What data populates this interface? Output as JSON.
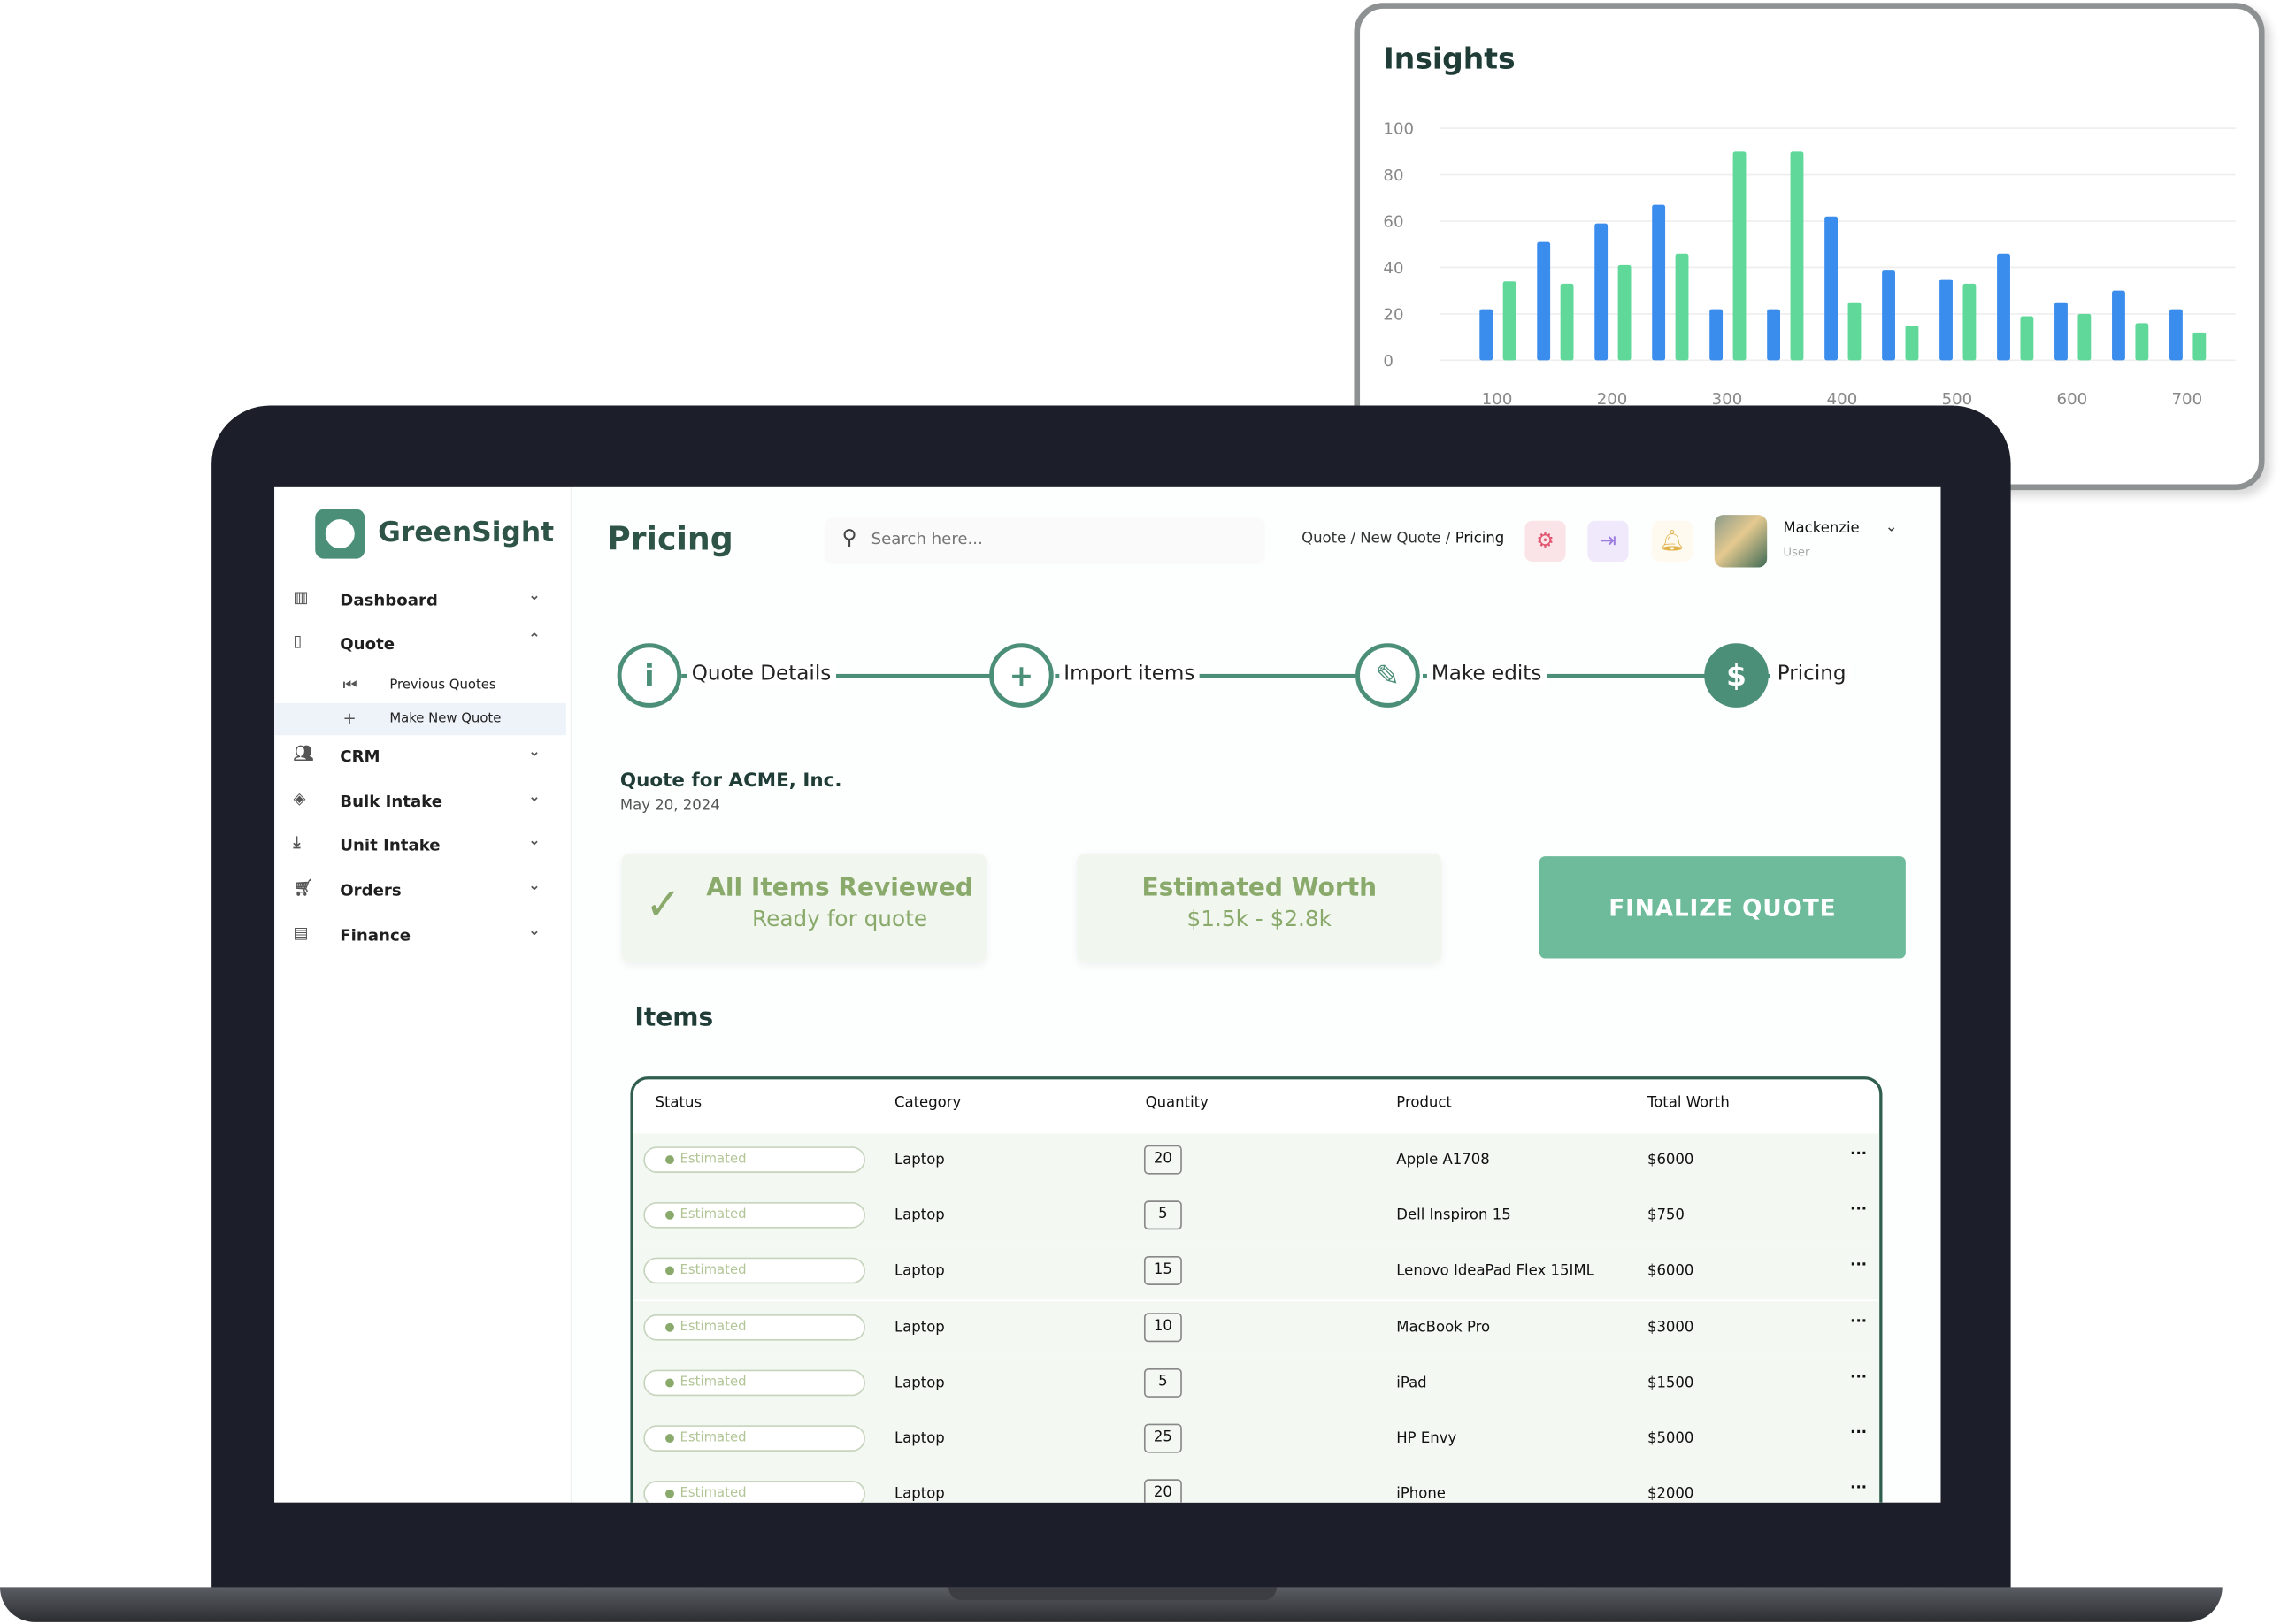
{
  "insights": {
    "title": "Insights"
  },
  "chart_data": {
    "type": "bar",
    "title": "Insights",
    "x": [
      100,
      150,
      200,
      250,
      300,
      350,
      400,
      450,
      500,
      550,
      600,
      650,
      700
    ],
    "x_ticks": [
      100,
      200,
      300,
      400,
      500,
      600,
      700
    ],
    "y_ticks": [
      0,
      20,
      40,
      60,
      80,
      100
    ],
    "ylim": [
      0,
      100
    ],
    "grid": true,
    "colors": [
      "#3b8ded",
      "#5fd899"
    ],
    "series": [
      {
        "values": [
          22,
          51,
          59,
          67,
          22,
          22,
          62,
          39,
          35,
          46,
          25,
          30,
          22
        ]
      },
      {
        "values": [
          34,
          33,
          41,
          46,
          90,
          90,
          25,
          15,
          33,
          19,
          20,
          16,
          12
        ]
      }
    ]
  },
  "app": {
    "brand": "GreenSight",
    "accent": "#4b8f78"
  },
  "sidebar": {
    "items": [
      {
        "label": "Dashboard",
        "icon": "dashboard-icon",
        "chevron": "⌄"
      },
      {
        "label": "Quote",
        "icon": "clipboard-icon",
        "chevron": "⌃"
      },
      {
        "label": "CRM",
        "icon": "users-icon",
        "chevron": "⌄"
      },
      {
        "label": "Bulk Intake",
        "icon": "layers-icon",
        "chevron": "⌄"
      },
      {
        "label": "Unit Intake",
        "icon": "download-icon",
        "chevron": "⌄"
      },
      {
        "label": "Orders",
        "icon": "cart-icon",
        "chevron": "⌄"
      },
      {
        "label": "Finance",
        "icon": "document-icon",
        "chevron": "⌄"
      }
    ],
    "sub": [
      {
        "label": "Previous Quotes",
        "icon": "skip-back-icon"
      },
      {
        "label": "Make New Quote",
        "icon": "plus-icon"
      }
    ]
  },
  "header": {
    "title": "Pricing",
    "search_placeholder": "Search here...",
    "breadcrumb": [
      "Quote",
      "New Quote",
      "Pricing"
    ],
    "user_name": "Mackenzie",
    "user_role": "User"
  },
  "steps": [
    {
      "label": "Quote Details",
      "icon": "info-icon"
    },
    {
      "label": "Import items",
      "icon": "plus-icon"
    },
    {
      "label": "Make edits",
      "icon": "pencil-icon"
    },
    {
      "label": "Pricing",
      "icon": "dollar-icon"
    }
  ],
  "quote": {
    "title": "Quote for ACME, Inc.",
    "date": "May 20, 2024"
  },
  "cards": {
    "reviewed_title": "All Items Reviewed",
    "reviewed_sub": "Ready for quote",
    "worth_title": "Estimated Worth",
    "worth_sub": "$1.5k - $2.8k",
    "finalize": "FINALIZE QUOTE"
  },
  "items": {
    "title": "Items",
    "columns": [
      "Status",
      "Category",
      "Quantity",
      "Product",
      "Total Worth"
    ],
    "rows": [
      {
        "status": "Estimated",
        "category": "Laptop",
        "quantity": "20",
        "product": "Apple A1708",
        "total": "$6000"
      },
      {
        "status": "Estimated",
        "category": "Laptop",
        "quantity": "5",
        "product": "Dell Inspiron 15",
        "total": "$750"
      },
      {
        "status": "Estimated",
        "category": "Laptop",
        "quantity": "15",
        "product": "Lenovo IdeaPad Flex 15IML",
        "total": "$6000"
      },
      {
        "status": "Estimated",
        "category": "Laptop",
        "quantity": "10",
        "product": "MacBook Pro",
        "total": "$3000"
      },
      {
        "status": "Estimated",
        "category": "Laptop",
        "quantity": "5",
        "product": "iPad",
        "total": "$1500"
      },
      {
        "status": "Estimated",
        "category": "Laptop",
        "quantity": "25",
        "product": "HP Envy",
        "total": "$5000"
      },
      {
        "status": "Estimated",
        "category": "Laptop",
        "quantity": "20",
        "product": "iPhone",
        "total": "$2000"
      }
    ]
  }
}
